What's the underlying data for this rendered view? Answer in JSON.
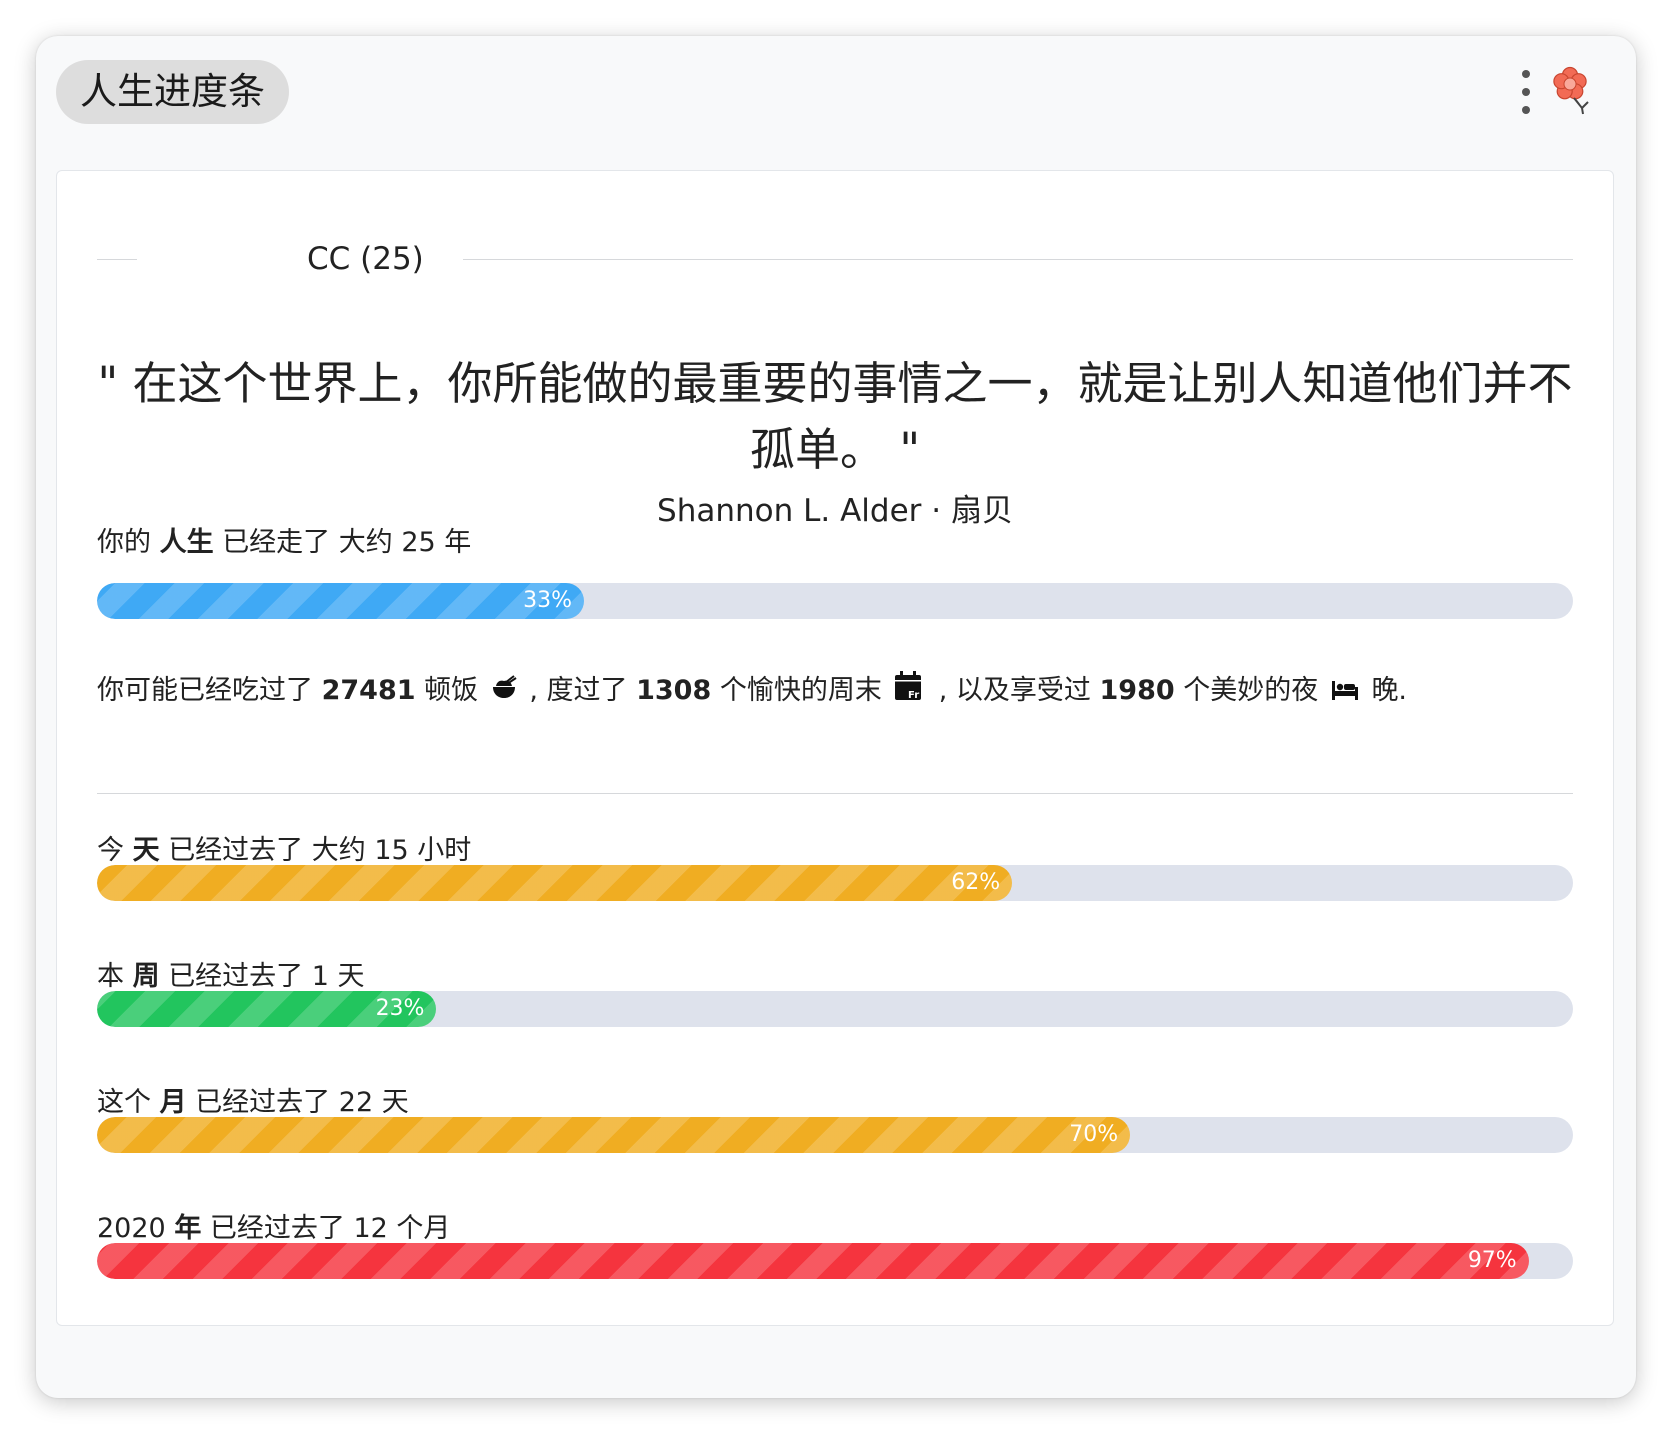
{
  "app": {
    "title": "人生进度条"
  },
  "profile": {
    "name": "CC (25)"
  },
  "quote": {
    "open_mark": "\"",
    "text": "在这个世界上，你所能做的最重要的事情之一，就是让别人知道他们并不孤单。",
    "close_mark": "\"",
    "author": "Shannon L. Alder · 扇贝"
  },
  "life": {
    "prefix": "你的",
    "subject": "人生",
    "suffix": "已经走了 大约 25 年",
    "percent": 33,
    "percent_label": "33%",
    "color": "#3fa9f5"
  },
  "stats": {
    "part1": "你可能已经吃过了",
    "meals": "27481",
    "meals_unit": "顿饭",
    "meals_icon": "rice-bowl-icon",
    "part2": ", 度过了",
    "weekends": "1308",
    "weekends_unit": "个愉快的周末",
    "weekend_icon": "calendar-fri-icon",
    "calendar_text": "Fr",
    "part3": ", 以及享受过",
    "nights": "1980",
    "nights_unit": "个美妙的夜",
    "night_icon": "bed-icon",
    "part4": "晚."
  },
  "progress": [
    {
      "prefix": "今",
      "subject": "天",
      "suffix": "已经过去了 大约 15 小时",
      "percent": 62,
      "percent_label": "62%",
      "color": "#f0ad22"
    },
    {
      "prefix": "本",
      "subject": "周",
      "suffix": "已经过去了 1 天",
      "percent": 23,
      "percent_label": "23%",
      "color": "#22c55e"
    },
    {
      "prefix": "这个",
      "subject": "月",
      "suffix": "已经过去了 22 天",
      "percent": 70,
      "percent_label": "70%",
      "color": "#f0ad22"
    },
    {
      "prefix": "2020",
      "subject": "年",
      "suffix": "已经过去了 12 个月",
      "percent": 97,
      "percent_label": "97%",
      "color": "#f5343e"
    }
  ],
  "icons": {
    "menu": "more-vertical-icon",
    "settings": "flower-icon"
  }
}
